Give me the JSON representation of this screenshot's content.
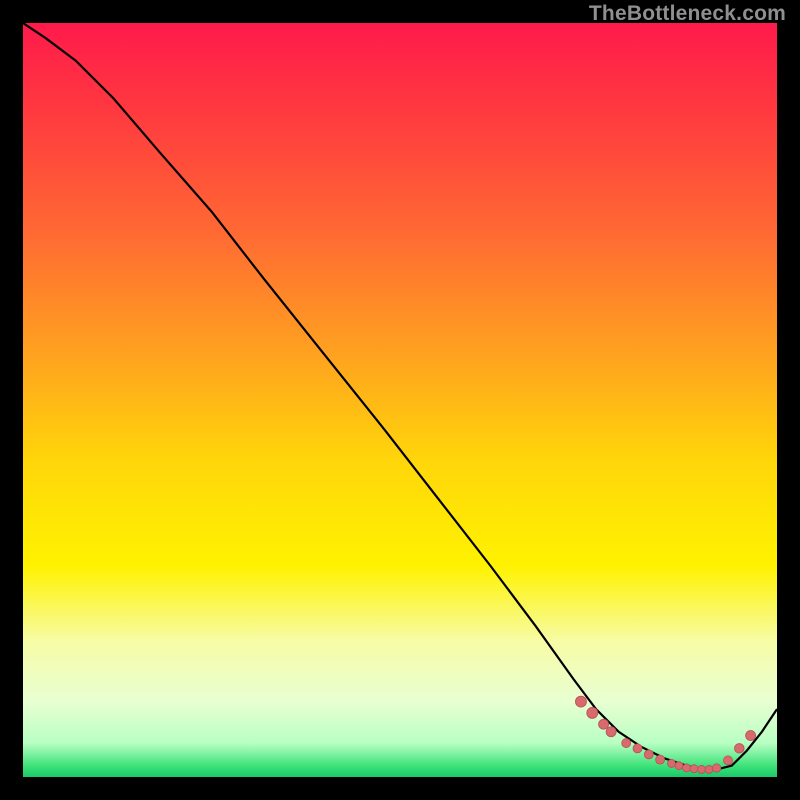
{
  "watermark": "TheBottleneck.com",
  "colors": {
    "frame": "#000000",
    "curve_stroke": "#000000",
    "marker_fill": "#d66a6d",
    "marker_stroke": "#b94f55",
    "gradient_stops": [
      {
        "offset": 0.0,
        "color": "#ff1a4b"
      },
      {
        "offset": 0.12,
        "color": "#ff3a3f"
      },
      {
        "offset": 0.28,
        "color": "#ff6a33"
      },
      {
        "offset": 0.44,
        "color": "#ffa21f"
      },
      {
        "offset": 0.58,
        "color": "#ffd60a"
      },
      {
        "offset": 0.72,
        "color": "#fff200"
      },
      {
        "offset": 0.82,
        "color": "#f7fca6"
      },
      {
        "offset": 0.9,
        "color": "#e8ffd2"
      },
      {
        "offset": 0.955,
        "color": "#b8ffc3"
      },
      {
        "offset": 0.985,
        "color": "#3fe27a"
      },
      {
        "offset": 1.0,
        "color": "#18c96a"
      }
    ]
  },
  "chart_data": {
    "type": "line",
    "title": "",
    "xlabel": "",
    "ylabel": "",
    "xlim": [
      0,
      100
    ],
    "ylim": [
      0,
      100
    ],
    "grid": false,
    "legend": false,
    "series": [
      {
        "name": "curve",
        "x": [
          0,
          3,
          7,
          12,
          18,
          25,
          32,
          40,
          48,
          55,
          62,
          68,
          73,
          76,
          79,
          82,
          85,
          88,
          90,
          92,
          94,
          96,
          98,
          100
        ],
        "y": [
          100,
          98,
          95,
          90,
          83,
          75,
          66,
          56,
          46,
          37,
          28,
          20,
          13,
          9,
          6,
          4,
          2.5,
          1.5,
          1,
          1,
          1.5,
          3.5,
          6,
          9
        ]
      }
    ],
    "markers": {
      "name": "highlight-points",
      "x": [
        74,
        75.5,
        77,
        78,
        80,
        81.5,
        83,
        84.5,
        86,
        87,
        88,
        89,
        90,
        91,
        92,
        93.5,
        95,
        96.5
      ],
      "y": [
        10,
        8.5,
        7,
        6,
        4.5,
        3.8,
        3,
        2.3,
        1.8,
        1.5,
        1.2,
        1.1,
        1,
        1,
        1.2,
        2.2,
        3.8,
        5.5
      ],
      "r": [
        5.5,
        5.5,
        5,
        5,
        4.5,
        4.5,
        4.5,
        4.5,
        4,
        4,
        4,
        4,
        4,
        4,
        4.2,
        4.5,
        4.8,
        5
      ]
    }
  }
}
